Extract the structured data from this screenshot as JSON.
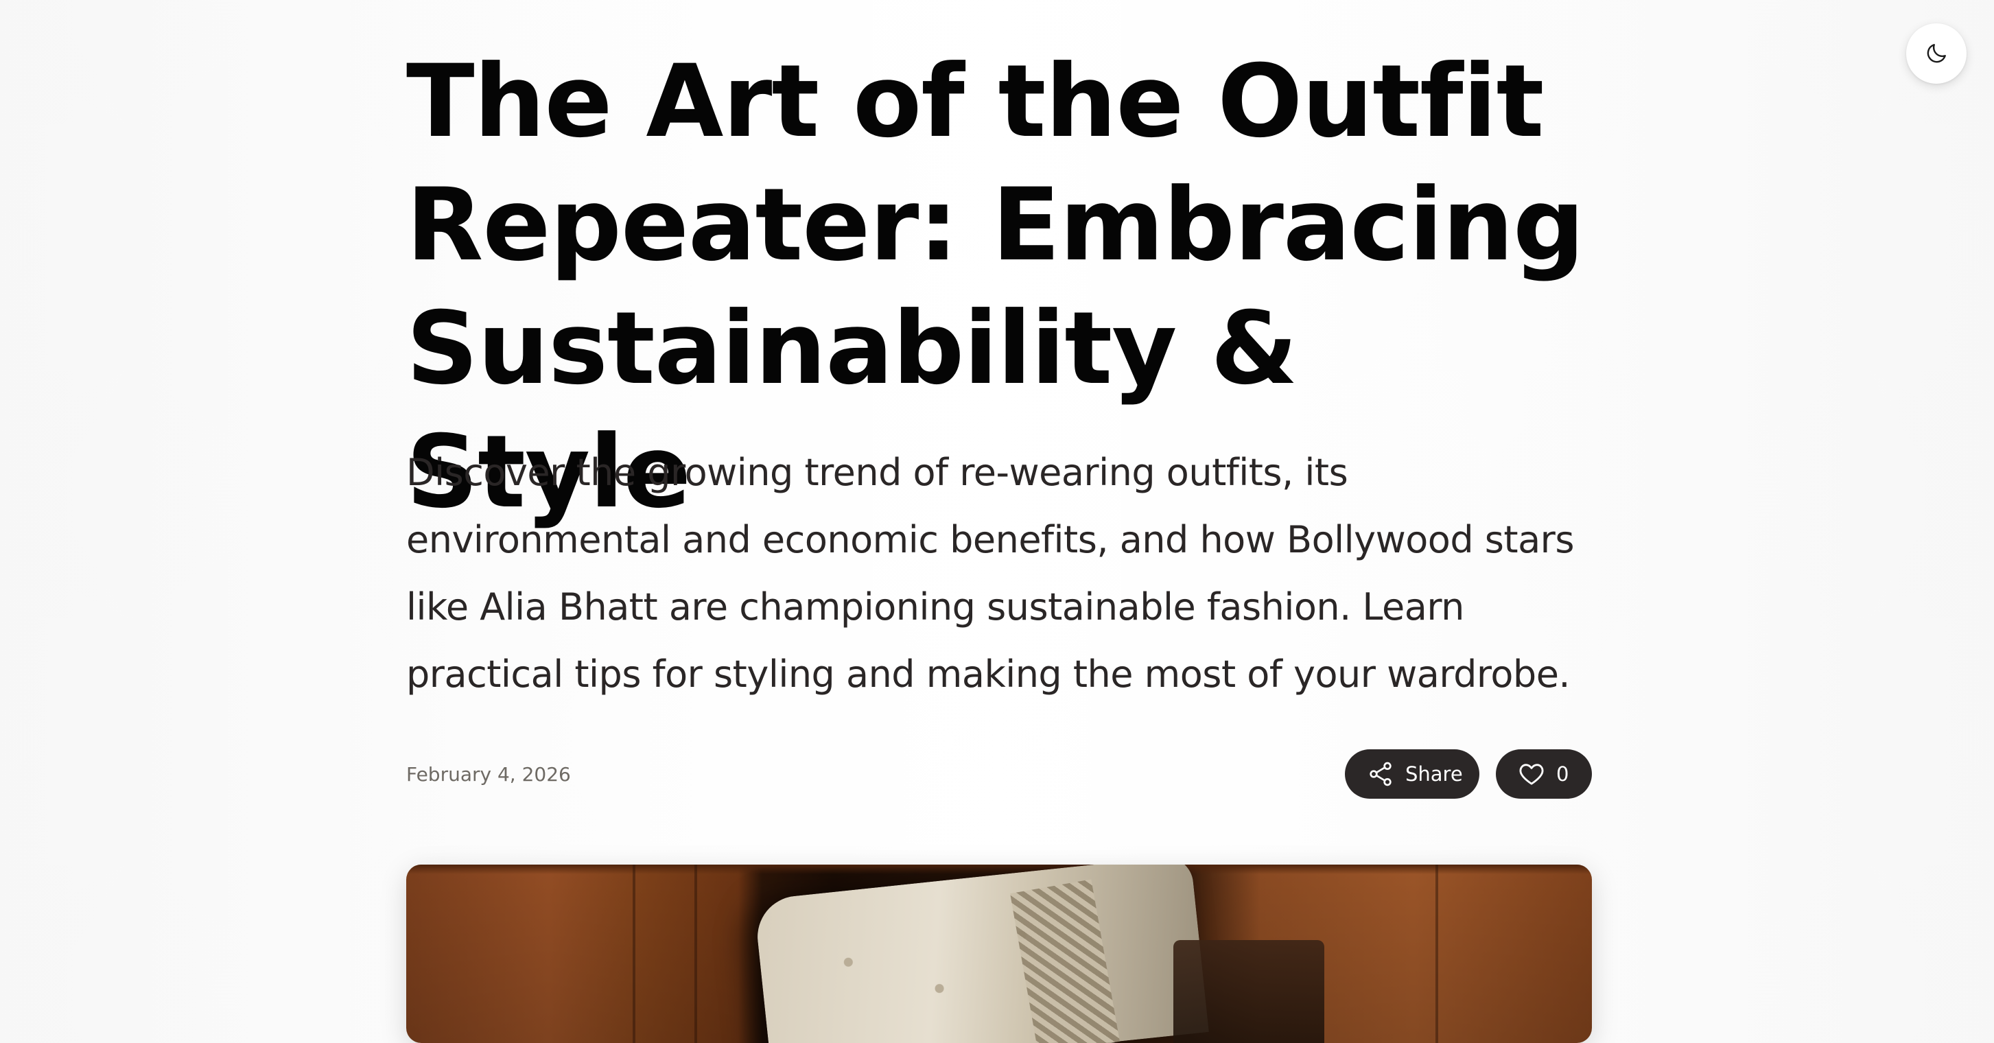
{
  "header": {
    "theme_toggle_icon": "moon-icon"
  },
  "article": {
    "title": "The Art of the Outfit\nRepeater: Embracing\nSustainability & Style",
    "summary": "Discover the growing trend of re-wearing outfits, its\nenvironmental and economic benefits, and how Bollywood stars\nlike Alia Bhatt are championing sustainable fashion. Learn\npractical tips for styling and making the most of your wardrobe.",
    "date": "February 4, 2026",
    "share_label": "Share",
    "share_icon": "share-icon",
    "like_count": "0",
    "like_icon": "heart-icon"
  },
  "colors": {
    "pill_background": "#2b2727",
    "title_text": "#050505",
    "summary_text": "#2a2626",
    "date_text": "#6e6a64"
  }
}
